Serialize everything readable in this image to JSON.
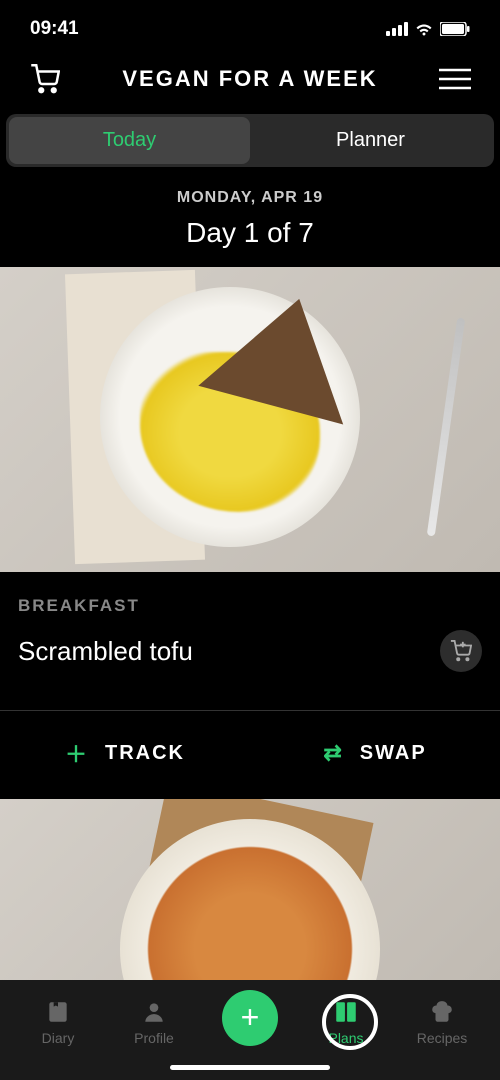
{
  "statusBar": {
    "time": "09:41"
  },
  "header": {
    "title": "VEGAN FOR A WEEK"
  },
  "tabs": {
    "today": "Today",
    "planner": "Planner"
  },
  "dateSection": {
    "date": "MONDAY, APR 19",
    "dayCount": "Day 1 of 7"
  },
  "meals": [
    {
      "type": "BREAKFAST",
      "name": "Scrambled tofu"
    }
  ],
  "actions": {
    "track": "TRACK",
    "swap": "SWAP"
  },
  "nav": {
    "diary": "Diary",
    "profile": "Profile",
    "plans": "Plans",
    "recipes": "Recipes"
  }
}
